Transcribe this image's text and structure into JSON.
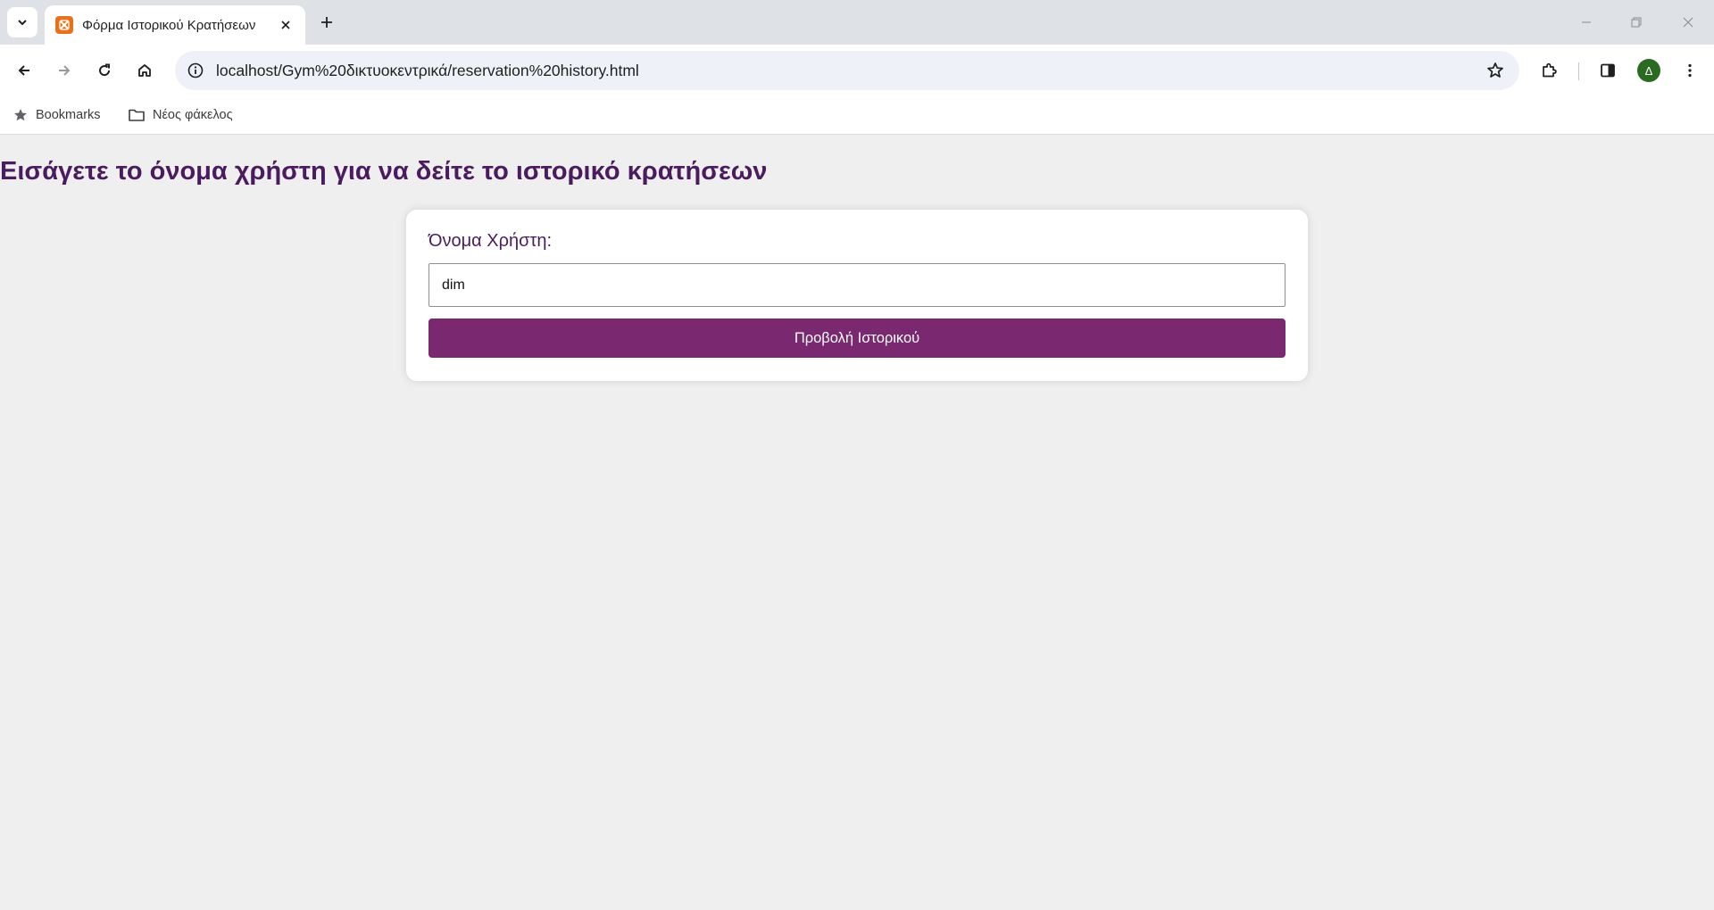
{
  "browser": {
    "tab": {
      "title": "Φόρμα Ιστορικού Κρατήσεων",
      "favicon_color": "#e8721c"
    },
    "address_bar": {
      "url": "localhost/Gym%20δικτυοκεντρικά/reservation%20history.html"
    },
    "profile_initial": "Δ",
    "profile_color": "#2b6a21",
    "bookmarks_bar": {
      "items": [
        {
          "label": "Bookmarks",
          "icon": "star-icon"
        },
        {
          "label": "Νέος φάκελος",
          "icon": "folder-icon"
        }
      ]
    }
  },
  "page": {
    "heading": "Εισάγετε το όνομα χρήστη για να δείτε το ιστορικό κρατήσεων",
    "form": {
      "username_label": "Όνομα Χρήστη:",
      "username_value": "dim",
      "submit_label": "Προβολή Ιστορικού"
    },
    "colors": {
      "heading": "#4a1b5e",
      "button": "#7a2870",
      "background": "#efefef"
    }
  }
}
